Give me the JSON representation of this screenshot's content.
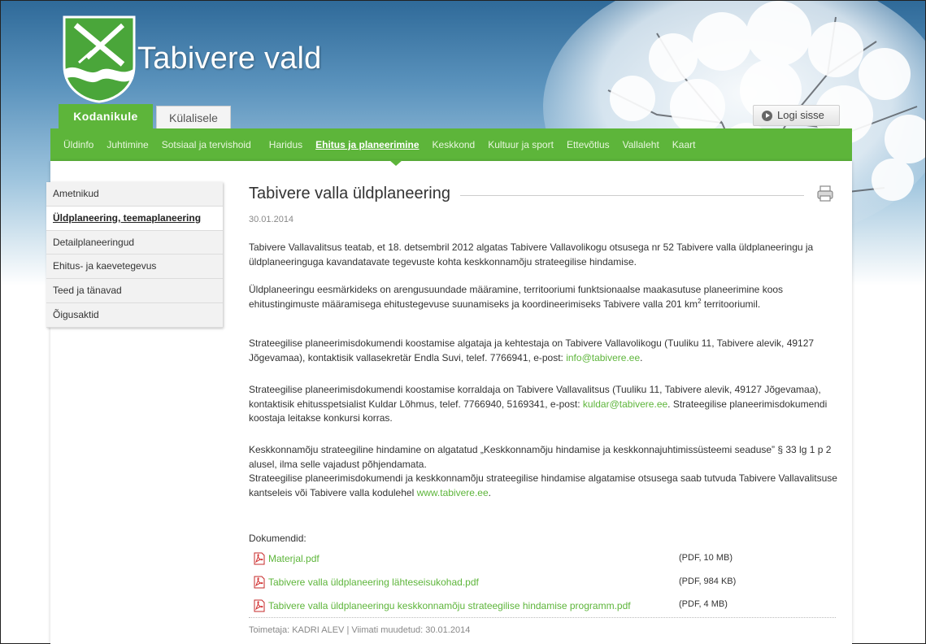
{
  "header": {
    "site_title": "Tabivere vald",
    "audience_tabs": [
      {
        "label": "Kodanikule",
        "active": true
      },
      {
        "label": "Külalisele",
        "active": false
      }
    ],
    "login_label": "Logi sisse"
  },
  "main_nav": {
    "items": [
      {
        "label": "Üldinfo"
      },
      {
        "label": "Juhtimine"
      },
      {
        "label": "Sotsiaal ja tervishoid"
      },
      {
        "label": "Haridus"
      },
      {
        "label": "Ehitus ja planeerimine",
        "active": true
      },
      {
        "label": "Keskkond"
      },
      {
        "label": "Kultuur ja sport"
      },
      {
        "label": "Ettevõtlus"
      },
      {
        "label": "Vallaleht"
      },
      {
        "label": "Kaart"
      }
    ]
  },
  "side_nav": {
    "items": [
      {
        "label": "Ametnikud"
      },
      {
        "label": "Üldplaneering, teemaplaneering",
        "active": true
      },
      {
        "label": "Detailplaneeringud"
      },
      {
        "label": "Ehitus- ja kaevetegevus"
      },
      {
        "label": "Teed ja tänavad"
      },
      {
        "label": "Õigusaktid"
      }
    ]
  },
  "article": {
    "title": "Tabivere valla üldplaneering",
    "date": "30.01.2014",
    "p1": "Tabivere Vallavalitsus teatab, et 18. detsembril 2012 algatas Tabivere Vallavolikogu otsusega nr 52 Tabivere valla üldplaneeringu ja üldplaneeringuga kavandatavate tegevuste kohta keskkonnamõju strateegilise hindamise.",
    "p2_text": "Üldplaneeringu eesmärkideks on arengusuundade määramine, territooriumi funktsionaalse maakasutuse planeerimine koos ehitustingimuste määramisega ehitustegevuse suunamiseks ja koordineerimiseks Tabivere valla 201 km",
    "p2_sup": "2",
    "p2_end": " territooriumil.",
    "p3_text": "Strateegilise planeerimisdokumendi koostamise algataja ja kehtestaja on Tabivere Vallavolikogu (Tuuliku 11, Tabivere alevik, 49127 Jõgevamaa), kontaktisik vallasekretär Endla Suvi, telef. 7766941, e-post: ",
    "p3_email": "info@tabivere.ee",
    "p3_end": ".",
    "p4_text": "Strateegilise planeerimisdokumendi koostamise korraldaja on Tabivere Vallavalitsus (Tuuliku 11, Tabivere alevik, 49127 Jõgevamaa), kontaktisik ehitusspetsialist Kuldar Lõhmus, telef. 7766940, 5169341, e-post: ",
    "p4_email": "kuldar@tabivere.ee",
    "p4_end": ". Strateegilise planeerimisdokumendi koostaja leitakse konkursi korras.",
    "p5_line1": "Keskkonnamõju strateegiline hindamine on algatatud „Keskkonnamõju hindamise ja keskkonnajuhtimissüsteemi seaduse” § 33 lg 1 p 2 alusel, ilma selle vajadust põhjendamata.",
    "p5_line2": "Strateegilise planeerimisdokumendi ja keskkonnamõju strateegilise hindamise algatamise otsusega saab tutvuda Tabivere Vallavalitsuse kantseleis või Tabivere valla kodulehel ",
    "p5_link": "www.tabivere.ee",
    "p5_end": ".",
    "documents_label": "Dokumendid:",
    "documents": [
      {
        "name": "Materjal.pdf",
        "size": "(PDF, 10 MB)"
      },
      {
        "name": "Tabivere valla üldplaneering lähteseisukohad.pdf",
        "size": "(PDF, 984 KB)"
      },
      {
        "name": "Tabivere valla üldplaneeringu keskkonnamõju strateegilise hindamise programm.pdf",
        "size": "(PDF, 4 MB)"
      }
    ],
    "footer_meta": "Toimetaja: KADRI ALEV | Viimati muudetud: 30.01.2014"
  },
  "colors": {
    "brand_green": "#5db53a",
    "link_green": "#5db53a"
  }
}
